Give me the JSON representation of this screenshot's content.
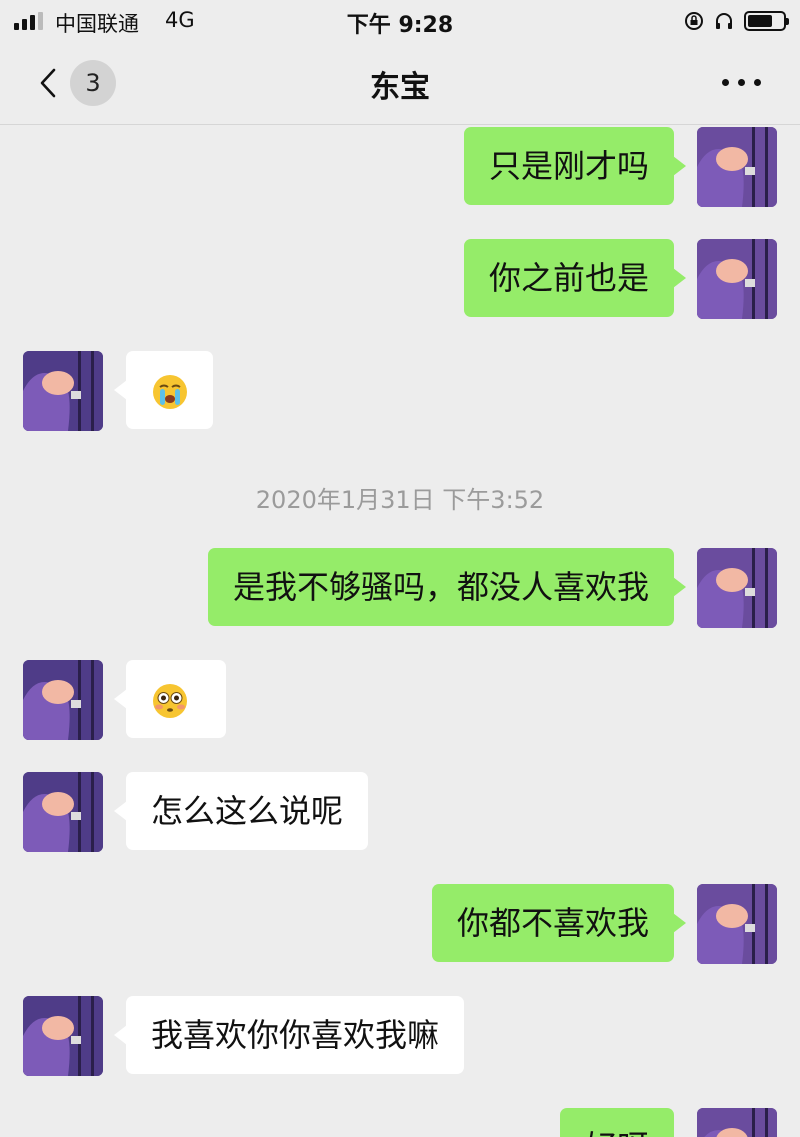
{
  "status_bar": {
    "carrier": "中国联通",
    "network": "4G",
    "time": "下午 9:28",
    "battery_level": 0.7
  },
  "nav": {
    "unread_count": "3",
    "title": "东宝"
  },
  "colors": {
    "self_bubble": "#95ec69",
    "other_bubble": "#ffffff",
    "background": "#ededed"
  },
  "messages": [
    {
      "sender": "self",
      "text": "只是刚才吗"
    },
    {
      "sender": "self",
      "text": "你之前也是"
    },
    {
      "sender": "other",
      "emoji": "crying-face-icon"
    },
    {
      "timestamp": "2020年1月31日 下午3:52"
    },
    {
      "sender": "self",
      "text": "是我不够骚吗，都没人喜欢我"
    },
    {
      "sender": "other",
      "emoji": "flushed-face-icon"
    },
    {
      "sender": "other",
      "text": "怎么这么说呢"
    },
    {
      "sender": "self",
      "text": "你都不喜欢我"
    },
    {
      "sender": "other",
      "text": "我喜欢你你喜欢我嘛"
    },
    {
      "sender": "self",
      "text": "好呀"
    }
  ]
}
